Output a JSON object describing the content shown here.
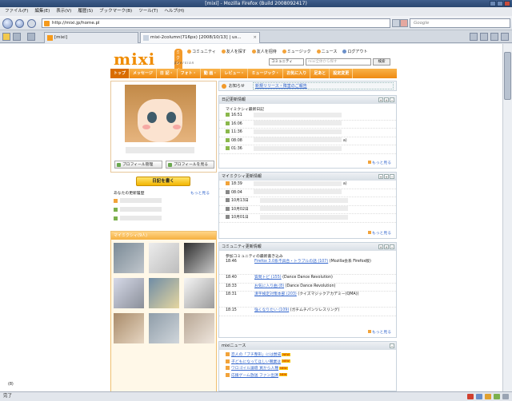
{
  "window": {
    "title": "[mixi] - Mozilla Firefox (Build 2008092417)"
  },
  "menu": [
    "ファイル(F)",
    "編集(E)",
    "表示(V)",
    "履歴(S)",
    "ブックマーク(B)",
    "ツール(T)",
    "ヘルプ(H)"
  ],
  "nav": {
    "url": "http://mixi.jp/home.pl",
    "search_placeholder": "Google"
  },
  "tabs": [
    {
      "label": "[mixi]",
      "active": false
    },
    {
      "label": "mixi-2column(716px) [2008/10/13] | us...",
      "active": true
    }
  ],
  "status": {
    "text": "完了"
  },
  "mixi": {
    "logo": "mixi",
    "logo_badge": "ミクシィ",
    "logo_ver": "βversion",
    "toplinks": [
      "コミュニティ",
      "友人を探す",
      "友人を招待",
      "ミュージック",
      "ニュース",
      "ログアウト"
    ],
    "search": {
      "select": "コミュニティ",
      "placeholder": "mixi全体から探す",
      "button": "検索"
    },
    "globalnav": [
      "トップ",
      "メッセージ",
      "日 記・",
      "フォト・",
      "動 画・",
      "レビュー・",
      "ミュージック・",
      "お気に入り",
      "足あと",
      "設定変更"
    ],
    "profile": {
      "btn_manage": "プロフィール管理",
      "btn_view": "プロフィールを見る"
    },
    "diary_button": "日記を書く",
    "newfriends": {
      "title": "あなたの更新履歴",
      "more": "もっと見る"
    },
    "friends": {
      "title": "マイミクシィ(9人)",
      "count": "(8)"
    },
    "notice": {
      "label": "お知らせ",
      "link": "新規リリース・障害のご報告"
    },
    "diary": {
      "title": "日記更新情報",
      "sub": "マイミクシィ最新日記",
      "rows": [
        {
          "time": "16:51"
        },
        {
          "time": "16:06"
        },
        {
          "time": "11:36"
        },
        {
          "time": "08:08",
          "tail": "a)"
        },
        {
          "time": "01:36"
        }
      ],
      "more": "もっと見る"
    },
    "mymixi": {
      "title": "マイミクシィ更新情報",
      "rows": [
        {
          "time": "18:39",
          "tail": "a)"
        },
        {
          "time": "08:04"
        },
        {
          "time": "10月13日"
        },
        {
          "time": "10月02日"
        },
        {
          "time": "10月01日"
        }
      ],
      "more": "もっと見る"
    },
    "community": {
      "title": "コミュニティ更新情報",
      "sub": "参加コミュニティの最新書き込み",
      "rows": [
        {
          "time": "18:46",
          "link": "Firefox 3.0系不具合・トラブルの話 (107)",
          "tail": "(Mozilla会系 Firefox版)"
        },
        {
          "time": "18:40",
          "link": "質問トピ (155)",
          "tail": "(Dance Dance Revolution)"
        },
        {
          "time": "18:33",
          "link": "お気に入り曲 (8)",
          "tail": "(Dance Dance Revolution)"
        },
        {
          "time": "18:31",
          "link": "漢字検定対策本部 (203)",
          "tail": "(クイズマジックアカデミー(QMA))"
        },
        {
          "time": "18:15",
          "link": "強くなりたい (109)",
          "tail": "(ガチムチパンツレスリング)"
        }
      ],
      "more": "もっと見る"
    },
    "news": {
      "title": "mixiニュース",
      "items": [
        "恋人の「ブチ整形」には賛成",
        "子どもになってほしい職業は",
        "ワロゴイル論壇 買から人種",
        "応援ゲーム放送 ファン出演"
      ],
      "new_badge": "NEW"
    }
  }
}
